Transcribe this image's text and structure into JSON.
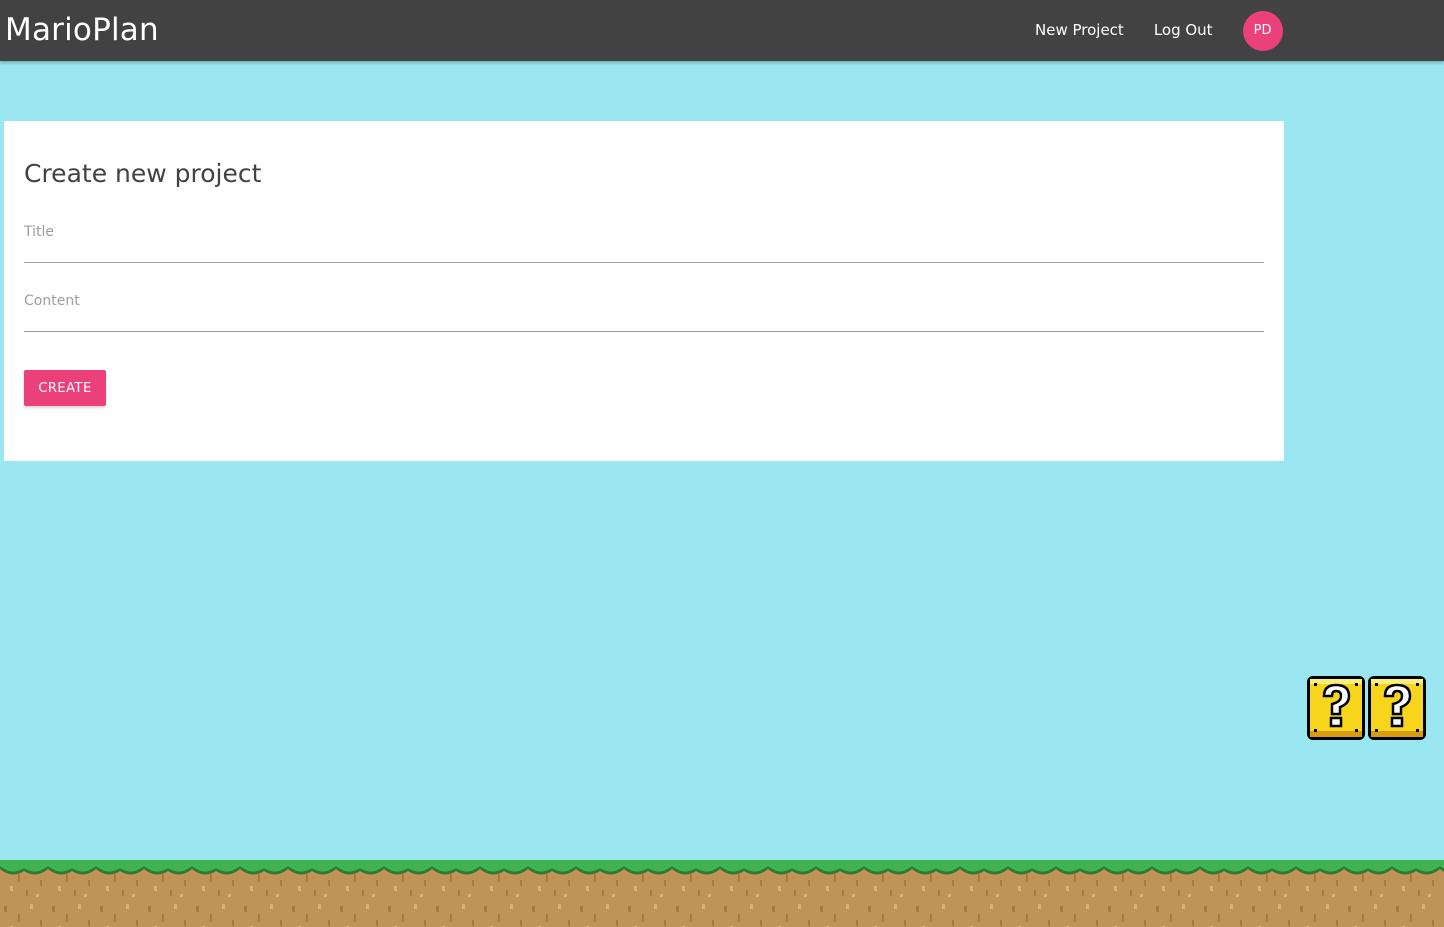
{
  "navbar": {
    "brand": "MarioPlan",
    "links": [
      {
        "label": "New Project"
      },
      {
        "label": "Log Out"
      }
    ],
    "avatar_initials": "PD"
  },
  "form": {
    "title": "Create new project",
    "fields": {
      "title_label": "Title",
      "title_value": "",
      "content_label": "Content",
      "content_value": ""
    },
    "submit_label": "CREATE"
  },
  "colors": {
    "navbar": "#424242",
    "sky": "#9ae7f2",
    "accent": "#ec407a",
    "card": "#ffffff",
    "grass": "#3fb34f",
    "dirt": "#c09458"
  },
  "decor": {
    "blocks_icon": "question-block-icon",
    "ground_icon": "grass-ground-icon"
  }
}
